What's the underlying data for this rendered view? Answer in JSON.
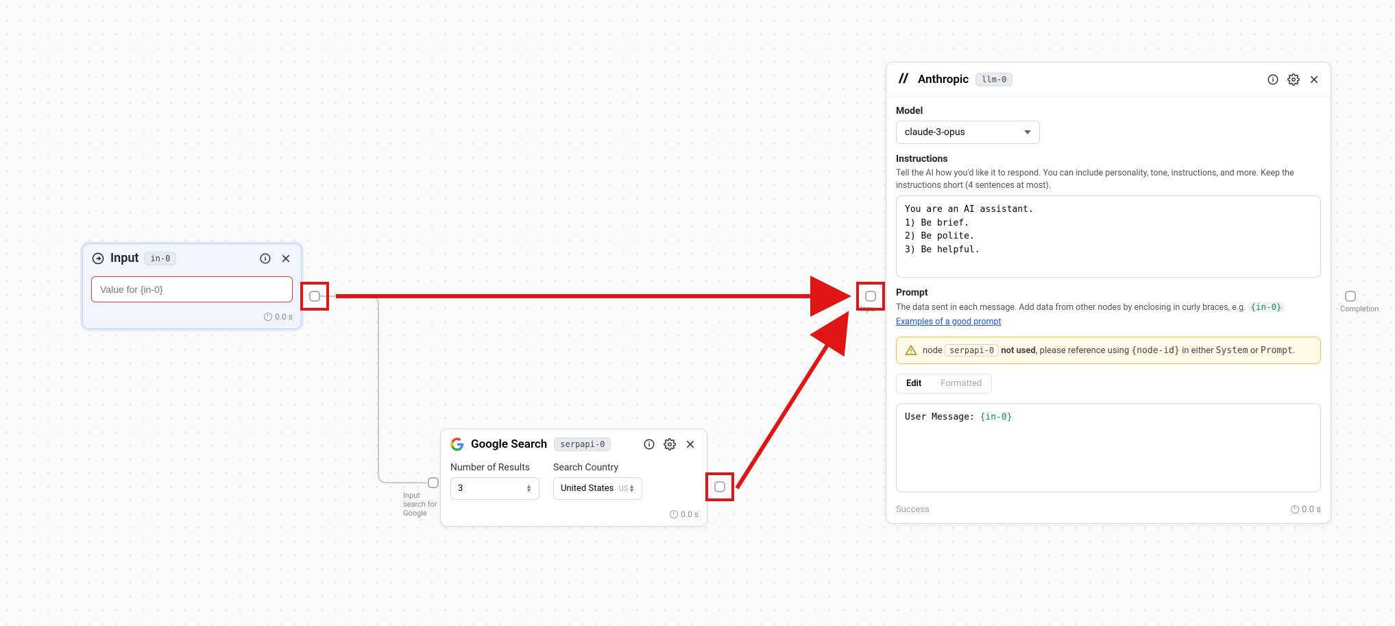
{
  "input_node": {
    "title": "Input",
    "badge": "in-0",
    "placeholder": "Value for {in-0}",
    "time": "0.0 s"
  },
  "google_node": {
    "title": "Google Search",
    "badge": "serpapi-0",
    "fields": {
      "num_label": "Number of Results",
      "num_value": "3",
      "country_label": "Search Country",
      "country_value": "United States",
      "country_code": "US"
    },
    "time": "0.0 s",
    "in_port_label": "Input search for Google"
  },
  "anthropic_node": {
    "title": "Anthropic",
    "badge": "llm-0",
    "model_label": "Model",
    "model_value": "claude-3-opus",
    "instructions_label": "Instructions",
    "instructions_help": "Tell the AI how you'd like it to respond. You can include personality, tone, instructions, and more. Keep the instructions short (4 sentences at most).",
    "instructions_value": "You are an AI assistant.\n1) Be brief.\n2) Be polite.\n3) Be helpful.",
    "prompt_label": "Prompt",
    "prompt_help_pre": "The data sent in each message. Add data from other nodes by enclosing in curly braces, e.g. ",
    "prompt_help_code": "{in-0}",
    "prompt_link": "Examples of a good prompt",
    "warn": {
      "lead": "node",
      "pill": "serpapi-0",
      "mid": " not used",
      "tail": ", please reference using ",
      "code1": "{node-id}",
      "mid2": " in either ",
      "code2": "System",
      "or": " or ",
      "code3": "Prompt",
      "dot": "."
    },
    "tabs": {
      "edit": "Edit",
      "formatted": "Formatted"
    },
    "prompt_value_pre": "User Message: ",
    "prompt_value_ref": "{in-0}",
    "status": "Success",
    "time": "0.0 s",
    "in_port_label": "Inpu",
    "out_port_label": "Completion"
  }
}
